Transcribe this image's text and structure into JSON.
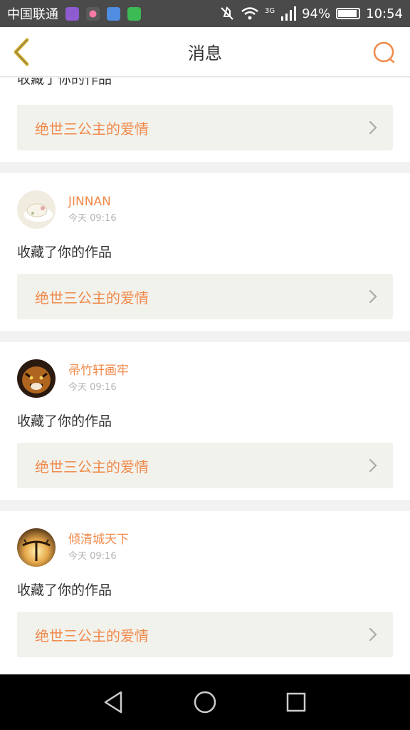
{
  "status_bar": {
    "carrier": "中国联通",
    "network": "3G",
    "battery": "94%",
    "battery_level": 0.94,
    "time": "10:54",
    "app_icon_colors": [
      "#8e5bd1",
      "#ff7aa8",
      "#4f8de0",
      "#3cba54"
    ]
  },
  "header": {
    "title": "消息",
    "back_icon": "chevron-left-icon",
    "search_icon": "search-icon"
  },
  "colors": {
    "accent": "#f08a4b",
    "back_chevron": "#d7b53a",
    "card_link_bg": "#f2f2ed",
    "page_bg": "#f2f2f2"
  },
  "notifications": [
    {
      "user": "",
      "time": "",
      "action": "收藏了你的作品",
      "work_title": "绝世三公主的爱情"
    },
    {
      "user": "JINNAN",
      "time": "今天 09:16",
      "action": "收藏了你的作品",
      "work_title": "绝世三公主的爱情"
    },
    {
      "user": "帚竹轩画牢",
      "time": "今天 09:16",
      "action": "收藏了你的作品",
      "work_title": "绝世三公主的爱情"
    },
    {
      "user": "倾清城天下",
      "time": "今天 09:16",
      "action": "收藏了你的作品",
      "work_title": "绝世三公主的爱情"
    }
  ],
  "nav_bar": {
    "back": "triangle-back-icon",
    "home": "circle-home-icon",
    "recents": "square-recents-icon"
  }
}
